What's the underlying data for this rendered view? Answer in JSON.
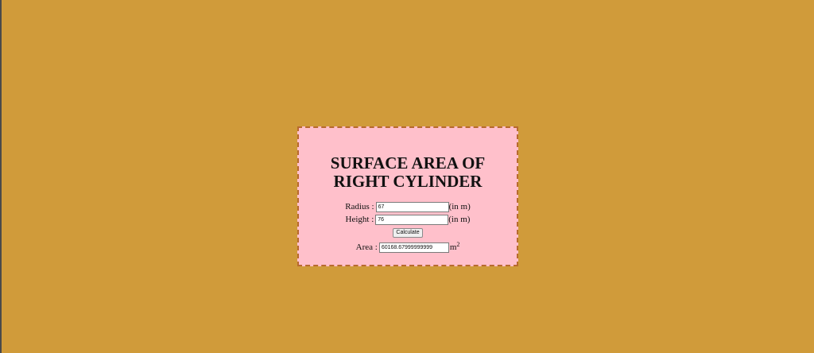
{
  "colors": {
    "page_background": "#d09b3a",
    "card_background": "#ffc0cb",
    "card_border": "#b86a2e"
  },
  "calculator": {
    "title_line1": "SURFACE AREA OF",
    "title_line2": "RIGHT CYLINDER",
    "radius": {
      "label": "Radius :",
      "value": "67",
      "unit": "(in m)"
    },
    "height": {
      "label": "Height :",
      "value": "76",
      "unit": "(in m)"
    },
    "calculate_button_label": "Calculate",
    "area": {
      "label": "Area :",
      "value": "60168.67999999999",
      "unit_base": "m",
      "unit_exponent": "2"
    }
  }
}
